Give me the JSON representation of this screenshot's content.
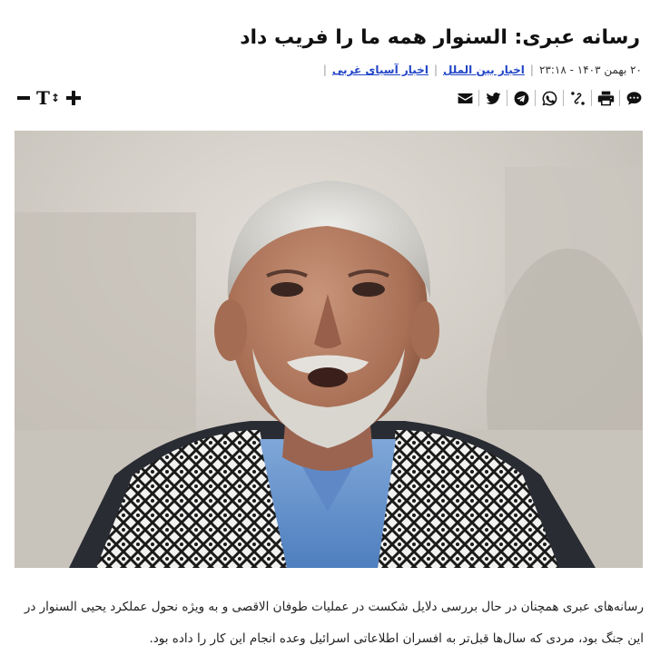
{
  "article": {
    "title": "رسانه عبری: السنوار همه ما را فریب داد",
    "date": "۲۰ بهمن ۱۴۰۳ - ۲۳:۱۸",
    "categories": [
      "اخبار بین الملل",
      "اخبار آسیای غربی"
    ],
    "caption": "رسانه‌های عبری همچنان در حال بررسی دلایل شکست در عملیات طوفان الاقصی و به ویژه نحول عملکرد یحیی السنوار در این جنگ بود، مردی که سال‌ها قبل‌تر به افسران اطلاعاتی اسرائیل وعده انجام این کار را داده بود."
  },
  "toolbar": {
    "share_icons": [
      "comment-icon",
      "print-icon",
      "link-icon",
      "whatsapp-icon",
      "telegram-icon",
      "twitter-icon",
      "email-icon"
    ],
    "font_controls": {
      "decrease_label": "−",
      "size_label": "T",
      "increase_label": "+"
    }
  },
  "photo": {
    "subject": "portrait"
  }
}
